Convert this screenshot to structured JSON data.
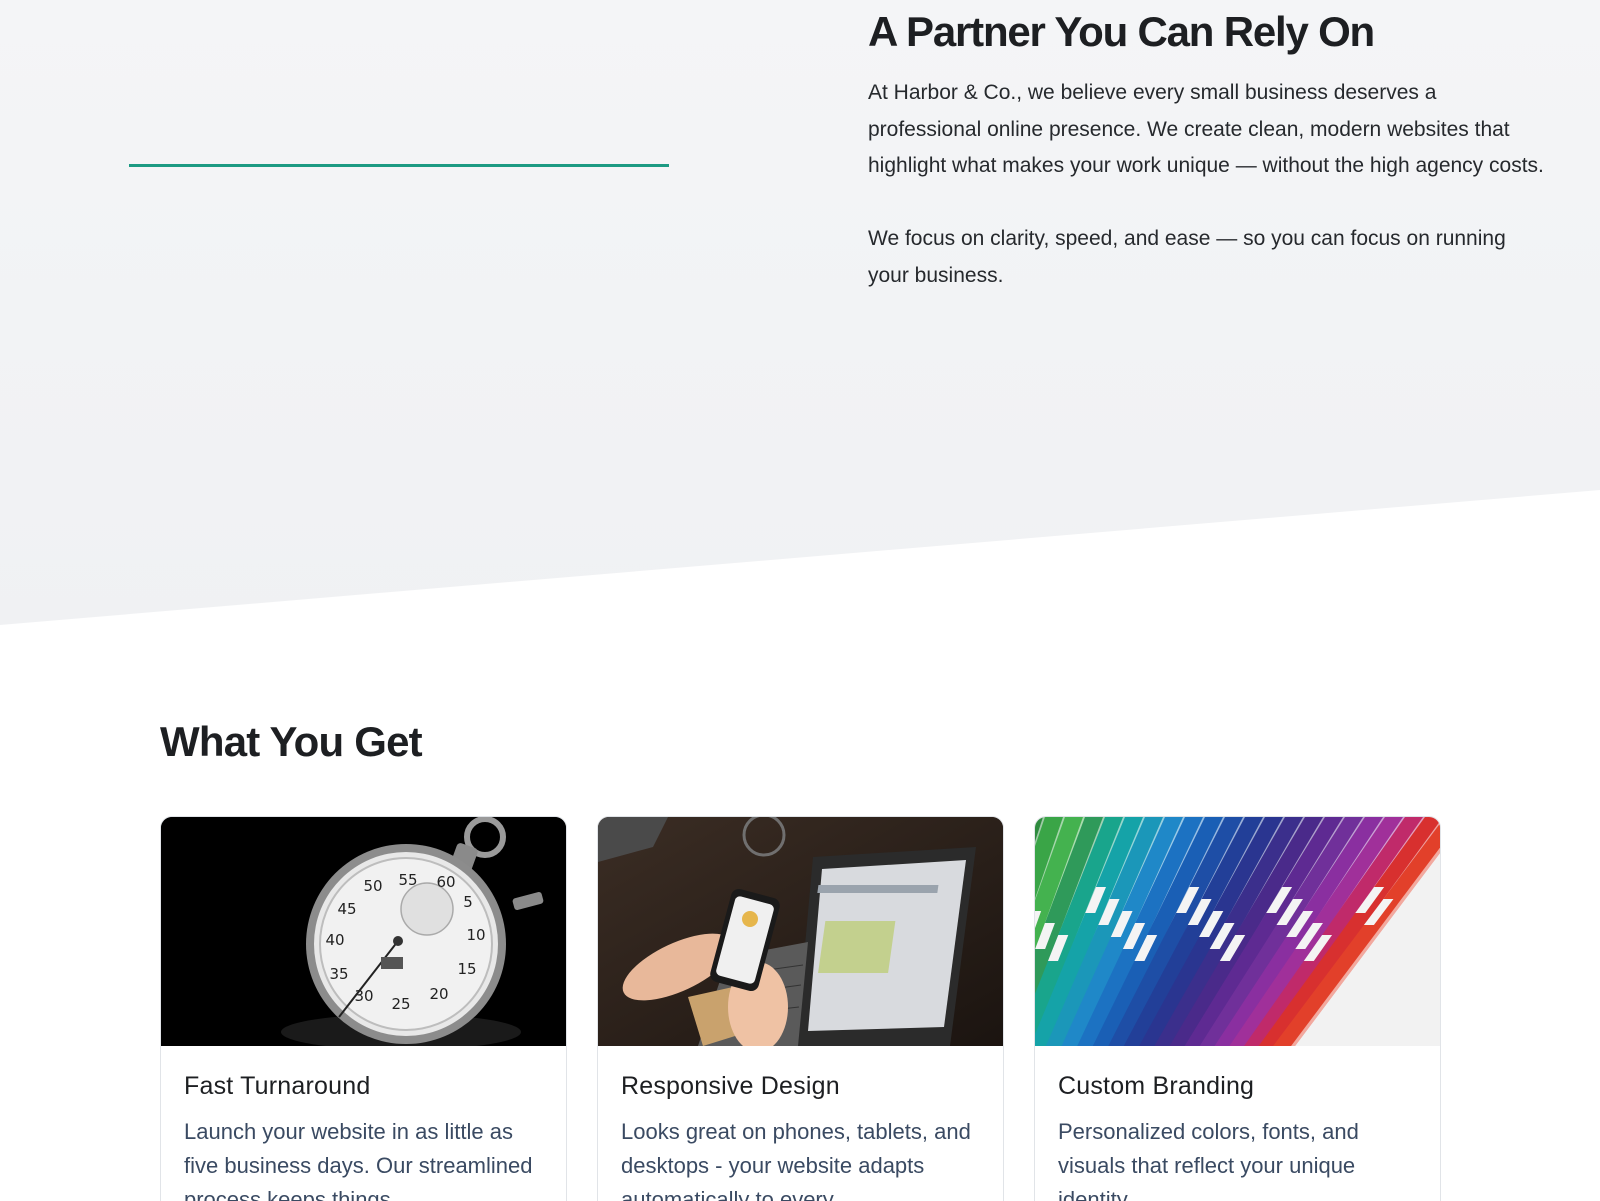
{
  "hero": {
    "title": "A Partner You Can Rely On",
    "paragraph1": "At Harbor & Co., we believe every small business deserves a professional online presence. We create clean, modern websites that highlight what makes your work unique — without the high agency costs.",
    "paragraph2": "We focus on clarity, speed, and ease — so you can focus on running your business.",
    "accent_color": "#1c9a83"
  },
  "features": {
    "title": "What You Get",
    "cards": [
      {
        "title": "Fast Turnaround",
        "text": "Launch your website in as little as five business days. Our streamlined process keeps things",
        "image": "stopwatch-photo"
      },
      {
        "title": "Responsive Design",
        "text": "Looks great on phones, tablets, and desktops - your website adapts automatically to every",
        "image": "laptop-phone-photo"
      },
      {
        "title": "Custom Branding",
        "text": "Personalized colors, fonts, and visuals that reflect your unique identity",
        "image": "color-swatches-photo"
      }
    ]
  }
}
